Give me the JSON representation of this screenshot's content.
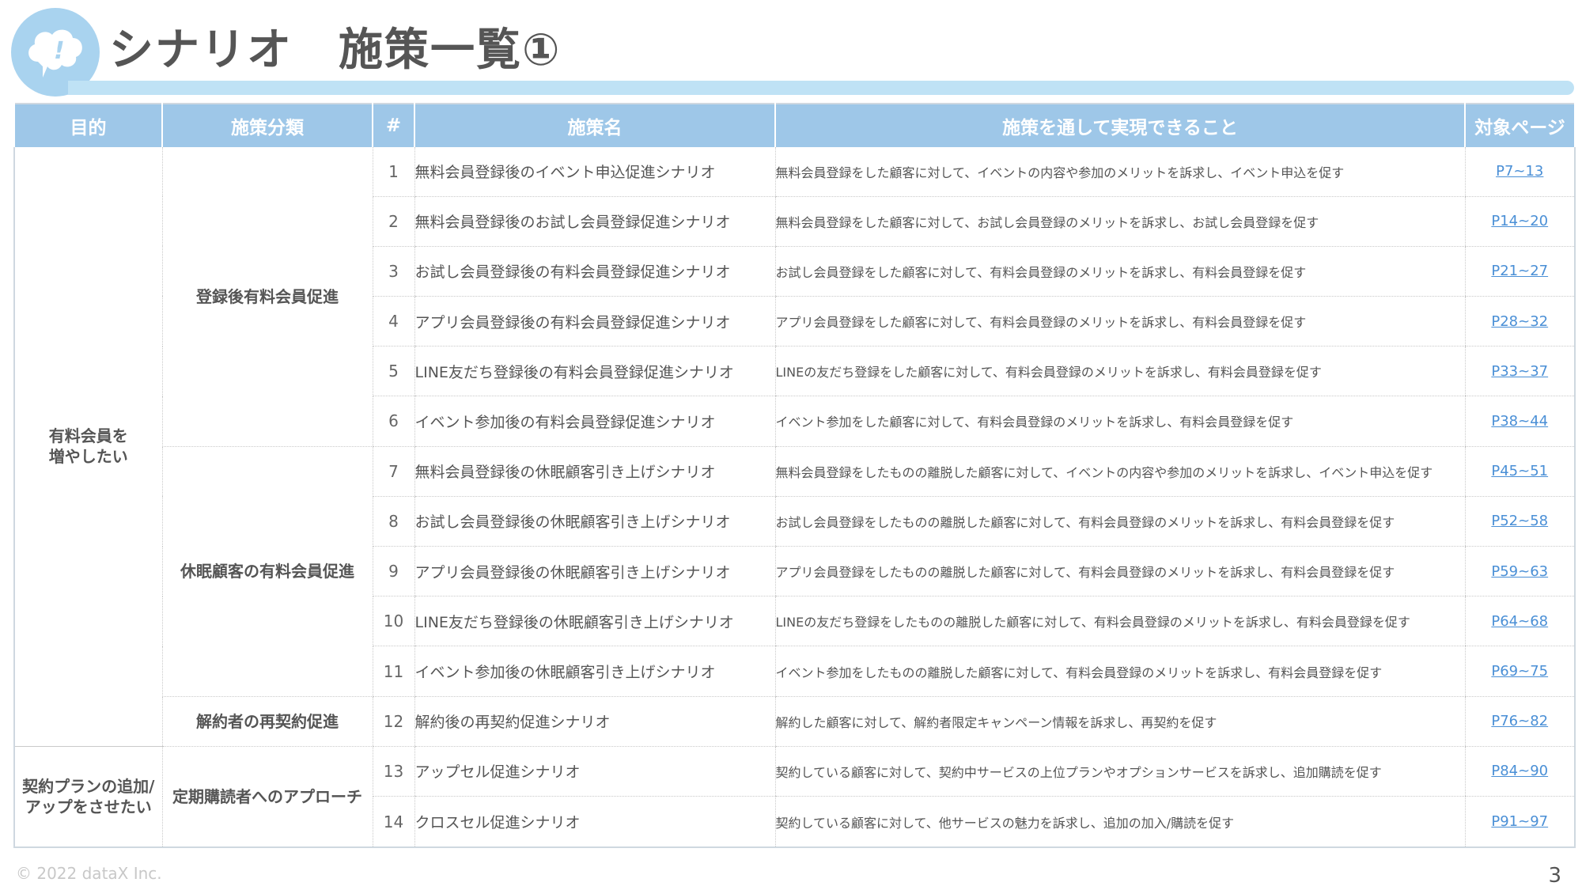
{
  "header": {
    "title": "シナリオ　施策一覧①"
  },
  "table": {
    "headers": [
      "目的",
      "施策分類",
      "#",
      "施策名",
      "施策を通して実現できること",
      "対象ページ"
    ],
    "goals": [
      "有料会員を\n増やしたい",
      "契約プランの追加/\nアップをさせたい"
    ],
    "categories": [
      "登録後有料会員促進",
      "休眠顧客の有料会員促進",
      "解約者の再契約促進",
      "定期購読者へのアプローチ"
    ],
    "rows": [
      {
        "num": "1",
        "name": "無料会員登録後のイベント申込促進シナリオ",
        "desc": "無料会員登録をした顧客に対して、イベントの内容や参加のメリットを訴求し、イベント申込を促す",
        "page": "P7~13"
      },
      {
        "num": "2",
        "name": "無料会員登録後のお試し会員登録促進シナリオ",
        "desc": "無料会員登録をした顧客に対して、お試し会員登録のメリットを訴求し、お試し会員登録を促す",
        "page": "P14~20"
      },
      {
        "num": "3",
        "name": "お試し会員登録後の有料会員登録促進シナリオ",
        "desc": "お試し会員登録をした顧客に対して、有料会員登録のメリットを訴求し、有料会員登録を促す",
        "page": "P21~27"
      },
      {
        "num": "4",
        "name": "アプリ会員登録後の有料会員登録促進シナリオ",
        "desc": "アプリ会員登録をした顧客に対して、有料会員登録のメリットを訴求し、有料会員登録を促す",
        "page": "P28~32"
      },
      {
        "num": "5",
        "name": "LINE友だち登録後の有料会員登録促進シナリオ",
        "desc": "LINEの友だち登録をした顧客に対して、有料会員登録のメリットを訴求し、有料会員登録を促す",
        "page": "P33~37"
      },
      {
        "num": "6",
        "name": "イベント参加後の有料会員登録促進シナリオ",
        "desc": "イベント参加をした顧客に対して、有料会員登録のメリットを訴求し、有料会員登録を促す",
        "page": "P38~44"
      },
      {
        "num": "7",
        "name": "無料会員登録後の休眠顧客引き上げシナリオ",
        "desc": "無料会員登録をしたものの離脱した顧客に対して、イベントの内容や参加のメリットを訴求し、イベント申込を促す",
        "page": "P45~51"
      },
      {
        "num": "8",
        "name": "お試し会員登録後の休眠顧客引き上げシナリオ",
        "desc": "お試し会員登録をしたものの離脱した顧客に対して、有料会員登録のメリットを訴求し、有料会員登録を促す",
        "page": "P52~58"
      },
      {
        "num": "9",
        "name": "アプリ会員登録後の休眠顧客引き上げシナリオ",
        "desc": "アプリ会員登録をしたものの離脱した顧客に対して、有料会員登録のメリットを訴求し、有料会員登録を促す",
        "page": "P59~63"
      },
      {
        "num": "10",
        "name": "LINE友だち登録後の休眠顧客引き上げシナリオ",
        "desc": "LINEの友だち登録をしたものの離脱した顧客に対して、有料会員登録のメリットを訴求し、有料会員登録を促す",
        "page": "P64~68"
      },
      {
        "num": "11",
        "name": "イベント参加後の休眠顧客引き上げシナリオ",
        "desc": "イベント参加をしたものの離脱した顧客に対して、有料会員登録のメリットを訴求し、有料会員登録を促す",
        "page": "P69~75"
      },
      {
        "num": "12",
        "name": "解約後の再契約促進シナリオ",
        "desc": "解約した顧客に対して、解約者限定キャンペーン情報を訴求し、再契約を促す",
        "page": "P76~82"
      },
      {
        "num": "13",
        "name": "アップセル促進シナリオ",
        "desc": "契約している顧客に対して、契約中サービスの上位プランやオプションサービスを訴求し、追加購読を促す",
        "page": "P84~90"
      },
      {
        "num": "14",
        "name": "クロスセル促進シナリオ",
        "desc": "契約している顧客に対して、他サービスの魅力を訴求し、追加の加入/購読を促す",
        "page": "P91~97"
      }
    ]
  },
  "footer": {
    "copyright": "© 2022 dataX Inc.",
    "page_number": "3"
  },
  "colors": {
    "header_fill": "#9ec7e8",
    "accent_light": "#bfe2f5",
    "logo_circle": "#a9d3ef",
    "link": "#4a8fd6"
  },
  "icons": {
    "logo": "thought-bubble-exclamation-icon"
  }
}
